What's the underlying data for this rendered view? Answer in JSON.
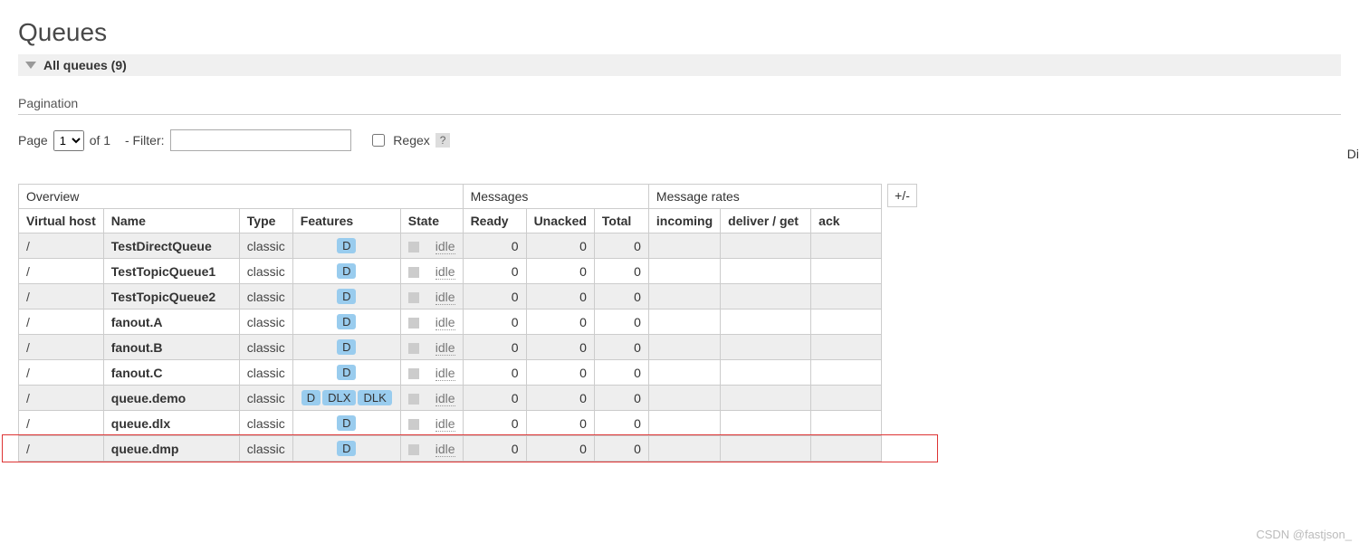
{
  "page_title": "Queues",
  "section": {
    "label": "All queues (9)"
  },
  "pagination": {
    "heading": "Pagination",
    "page_label": "Page",
    "page_value": "1",
    "of_text": "of 1",
    "filter_label": "- Filter:",
    "filter_value": "",
    "regex_label": "Regex",
    "help": "?",
    "right_cut": "Di"
  },
  "table": {
    "groups": [
      "Overview",
      "Messages",
      "Message rates"
    ],
    "columns": [
      "Virtual host",
      "Name",
      "Type",
      "Features",
      "State",
      "Ready",
      "Unacked",
      "Total",
      "incoming",
      "deliver / get",
      "ack"
    ],
    "plusminus": "+/-",
    "rows": [
      {
        "vhost": "/",
        "name": "TestDirectQueue",
        "type": "classic",
        "features": [
          "D"
        ],
        "state": "idle",
        "ready": "0",
        "unacked": "0",
        "total": "0",
        "incoming": "",
        "deliver": "",
        "ack": ""
      },
      {
        "vhost": "/",
        "name": "TestTopicQueue1",
        "type": "classic",
        "features": [
          "D"
        ],
        "state": "idle",
        "ready": "0",
        "unacked": "0",
        "total": "0",
        "incoming": "",
        "deliver": "",
        "ack": ""
      },
      {
        "vhost": "/",
        "name": "TestTopicQueue2",
        "type": "classic",
        "features": [
          "D"
        ],
        "state": "idle",
        "ready": "0",
        "unacked": "0",
        "total": "0",
        "incoming": "",
        "deliver": "",
        "ack": ""
      },
      {
        "vhost": "/",
        "name": "fanout.A",
        "type": "classic",
        "features": [
          "D"
        ],
        "state": "idle",
        "ready": "0",
        "unacked": "0",
        "total": "0",
        "incoming": "",
        "deliver": "",
        "ack": ""
      },
      {
        "vhost": "/",
        "name": "fanout.B",
        "type": "classic",
        "features": [
          "D"
        ],
        "state": "idle",
        "ready": "0",
        "unacked": "0",
        "total": "0",
        "incoming": "",
        "deliver": "",
        "ack": ""
      },
      {
        "vhost": "/",
        "name": "fanout.C",
        "type": "classic",
        "features": [
          "D"
        ],
        "state": "idle",
        "ready": "0",
        "unacked": "0",
        "total": "0",
        "incoming": "",
        "deliver": "",
        "ack": ""
      },
      {
        "vhost": "/",
        "name": "queue.demo",
        "type": "classic",
        "features": [
          "D",
          "DLX",
          "DLK"
        ],
        "state": "idle",
        "ready": "0",
        "unacked": "0",
        "total": "0",
        "incoming": "",
        "deliver": "",
        "ack": ""
      },
      {
        "vhost": "/",
        "name": "queue.dlx",
        "type": "classic",
        "features": [
          "D"
        ],
        "state": "idle",
        "ready": "0",
        "unacked": "0",
        "total": "0",
        "incoming": "",
        "deliver": "",
        "ack": ""
      },
      {
        "vhost": "/",
        "name": "queue.dmp",
        "type": "classic",
        "features": [
          "D"
        ],
        "state": "idle",
        "ready": "0",
        "unacked": "0",
        "total": "0",
        "incoming": "",
        "deliver": "",
        "ack": ""
      }
    ]
  },
  "watermark": "CSDN @fastjson_"
}
